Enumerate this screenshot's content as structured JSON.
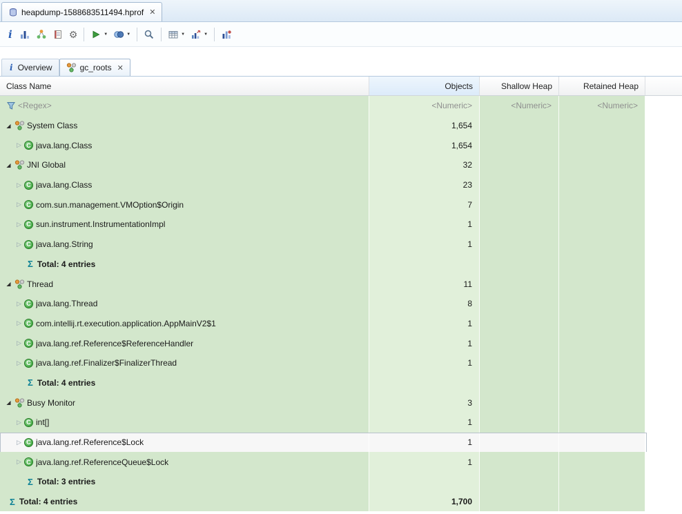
{
  "editor": {
    "tab_title": "heapdump-1588683511494.hprof"
  },
  "icons": {
    "close": "✕",
    "dropdown": "▼",
    "expanded": "◢",
    "collapsed": "▷",
    "sigma": "Σ",
    "class_letter": "C",
    "info_letter": "i",
    "gear": "⚙"
  },
  "toolbar": {
    "items": [
      {
        "name": "info",
        "dropdown": false
      },
      {
        "name": "histogram",
        "dropdown": false
      },
      {
        "name": "dominator-tree",
        "dropdown": false
      },
      {
        "name": "oql",
        "dropdown": false
      },
      {
        "name": "expert-system",
        "dropdown": false
      },
      {
        "name": "run-report",
        "dropdown": true
      },
      {
        "name": "query-browser",
        "dropdown": true
      },
      {
        "name": "search",
        "dropdown": false
      },
      {
        "name": "grouping",
        "dropdown": true
      },
      {
        "name": "export",
        "dropdown": true
      },
      {
        "name": "compare",
        "dropdown": false
      }
    ],
    "separators_after": [
      4,
      6,
      7,
      9
    ]
  },
  "subtabs": [
    {
      "label": "Overview",
      "icon": "info",
      "active": false,
      "closable": false
    },
    {
      "label": "gc_roots",
      "icon": "gc-roots",
      "active": true,
      "closable": true
    }
  ],
  "table": {
    "columns": [
      {
        "key": "name",
        "label": "Class Name"
      },
      {
        "key": "objects",
        "label": "Objects"
      },
      {
        "key": "shallow",
        "label": "Shallow Heap"
      },
      {
        "key": "retained",
        "label": "Retained Heap"
      }
    ],
    "rows": [
      {
        "type": "filter",
        "label": "<Regex>",
        "objects": "<Numeric>",
        "shallow": "<Numeric>",
        "retained": "<Numeric>"
      },
      {
        "type": "group",
        "label": "System Class",
        "objects": "1,654",
        "shallow": "",
        "retained": ""
      },
      {
        "type": "class",
        "label": "java.lang.Class",
        "objects": "1,654",
        "shallow": "",
        "retained": ""
      },
      {
        "type": "group",
        "label": "JNI Global",
        "objects": "32",
        "shallow": "",
        "retained": ""
      },
      {
        "type": "class",
        "label": "java.lang.Class",
        "objects": "23",
        "shallow": "",
        "retained": ""
      },
      {
        "type": "class",
        "label": "com.sun.management.VMOption$Origin",
        "objects": "7",
        "shallow": "",
        "retained": ""
      },
      {
        "type": "class",
        "label": "sun.instrument.InstrumentationImpl",
        "objects": "1",
        "shallow": "",
        "retained": ""
      },
      {
        "type": "class",
        "label": "java.lang.String",
        "objects": "1",
        "shallow": "",
        "retained": ""
      },
      {
        "type": "total",
        "label": "Total: 4 entries",
        "objects": "",
        "shallow": "",
        "retained": ""
      },
      {
        "type": "group",
        "label": "Thread",
        "objects": "11",
        "shallow": "",
        "retained": ""
      },
      {
        "type": "class",
        "label": "java.lang.Thread",
        "objects": "8",
        "shallow": "",
        "retained": ""
      },
      {
        "type": "class",
        "label": "com.intellij.rt.execution.application.AppMainV2$1",
        "objects": "1",
        "shallow": "",
        "retained": ""
      },
      {
        "type": "class",
        "label": "java.lang.ref.Reference$ReferenceHandler",
        "objects": "1",
        "shallow": "",
        "retained": ""
      },
      {
        "type": "class",
        "label": "java.lang.ref.Finalizer$FinalizerThread",
        "objects": "1",
        "shallow": "",
        "retained": ""
      },
      {
        "type": "total",
        "label": "Total: 4 entries",
        "objects": "",
        "shallow": "",
        "retained": ""
      },
      {
        "type": "group",
        "label": "Busy Monitor",
        "objects": "3",
        "shallow": "",
        "retained": ""
      },
      {
        "type": "class",
        "label": "int[]",
        "objects": "1",
        "shallow": "",
        "retained": ""
      },
      {
        "type": "class",
        "label": "java.lang.ref.Reference$Lock",
        "objects": "1",
        "shallow": "",
        "retained": "",
        "selected": true
      },
      {
        "type": "class",
        "label": "java.lang.ref.ReferenceQueue$Lock",
        "objects": "1",
        "shallow": "",
        "retained": ""
      },
      {
        "type": "total",
        "label": "Total: 3 entries",
        "objects": "",
        "shallow": "",
        "retained": ""
      },
      {
        "type": "grand_total",
        "label": "Total: 4 entries",
        "objects": "1,700",
        "shallow": "",
        "retained": ""
      }
    ]
  },
  "colors": {
    "row_green": "#d3e7cc",
    "objects_column_green": "#e1f0da",
    "sorted_header_blue": "#dcebfa",
    "selection_bg": "#f7f7f7",
    "sigma_teal": "#0e8296",
    "class_icon_green": "#2f9e2f"
  }
}
